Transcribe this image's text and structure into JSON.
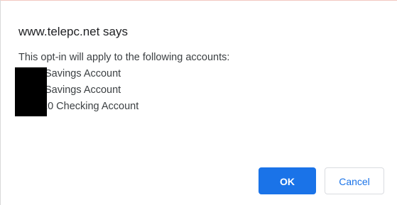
{
  "dialog": {
    "title": "www.telepc.net says",
    "message": "This opt-in will apply to the following accounts:",
    "accounts": [
      "Savings Account",
      "Savings Account",
      "20 Checking Account"
    ],
    "ok_label": "OK",
    "cancel_label": "Cancel"
  },
  "colors": {
    "primary": "#1a73e8",
    "redaction": "#000000"
  }
}
